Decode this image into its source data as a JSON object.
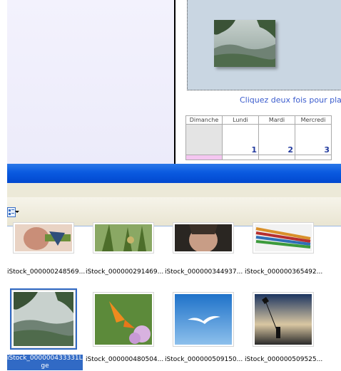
{
  "calendar": {
    "instruction": "Cliquez deux fois pour placer",
    "headers": [
      "Dimanche",
      "Lundi",
      "Mardi",
      "Mercredi"
    ],
    "days": [
      "",
      "1",
      "2",
      "3"
    ]
  },
  "files": {
    "row1": [
      "iStock_000000248569...",
      "iStock_000000291469...",
      "iStock_000000344937...",
      "iStock_000000365492..."
    ],
    "row2": [
      "iStock_000000433331Large",
      "iStock_000000480504...",
      "iStock_000000509150...",
      "iStock_000000509525..."
    ],
    "selected_caption_line1": "iStock_000000433331Lar",
    "selected_caption_line2": "ge"
  },
  "colors": {
    "selection": "#316ac5",
    "titlebar": "#0a5ae0",
    "link_blue": "#3b5ccd"
  }
}
